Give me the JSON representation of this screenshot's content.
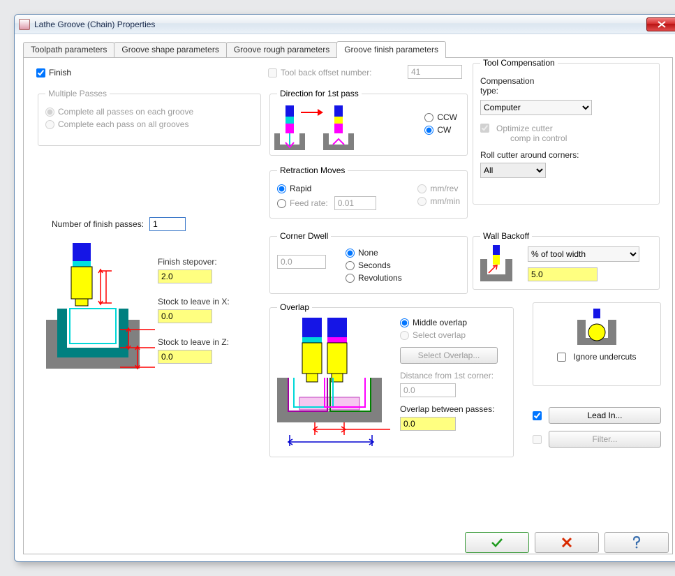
{
  "window": {
    "title": "Lathe Groove (Chain) Properties"
  },
  "tabs": [
    {
      "label": "Toolpath parameters"
    },
    {
      "label": "Groove shape parameters"
    },
    {
      "label": "Groove rough parameters"
    },
    {
      "label": "Groove finish parameters"
    }
  ],
  "finish": {
    "label": "Finish",
    "checked": true
  },
  "multiplePasses": {
    "legend": "Multiple Passes",
    "opt1": "Complete all passes on each groove",
    "opt2": "Complete each pass on all grooves",
    "selected": 0
  },
  "numberFinishPasses": {
    "label": "Number of finish passes:",
    "value": "1"
  },
  "finishStepover": {
    "label": "Finish stepover:",
    "value": "2.0"
  },
  "stockX": {
    "label": "Stock to leave in X:",
    "value": "0.0"
  },
  "stockZ": {
    "label": "Stock to leave in Z:",
    "value": "0.0"
  },
  "toolBackOffset": {
    "label": "Tool back offset number:",
    "checked": false,
    "value": "41"
  },
  "direction": {
    "legend": "Direction for 1st pass",
    "ccw": "CCW",
    "cw": "CW",
    "selected": "cw"
  },
  "retraction": {
    "legend": "Retraction Moves",
    "rapid": "Rapid",
    "feed": "Feed rate:",
    "value": "0.01",
    "mmrev": "mm/rev",
    "mmmin": "mm/min",
    "selected": "rapid"
  },
  "cornerDwell": {
    "legend": "Corner Dwell",
    "value": "0.0",
    "none": "None",
    "seconds": "Seconds",
    "rev": "Revolutions",
    "selected": "none"
  },
  "overlap": {
    "legend": "Overlap",
    "middle": "Middle overlap",
    "select": "Select overlap",
    "selectBtn": "Select Overlap...",
    "distLabel": "Distance from 1st corner:",
    "distValue": "0.0",
    "betweenLabel": "Overlap between passes:",
    "betweenValue": "0.0",
    "selected": "middle"
  },
  "toolComp": {
    "legend": "Tool Compensation",
    "typeLabel": "Compensation type:",
    "typeValue": "Computer",
    "optimize": "Optimize cutter comp in control",
    "rollLabel": "Roll cutter around corners:",
    "rollValue": "All"
  },
  "wallBackoff": {
    "legend": "Wall Backoff",
    "mode": "% of tool width",
    "value": "5.0"
  },
  "ignoreUndercuts": {
    "label": "Ignore undercuts",
    "checked": false
  },
  "leadIn": {
    "label": "Lead In...",
    "checked": true
  },
  "filter": {
    "label": "Filter...",
    "checked": false
  }
}
